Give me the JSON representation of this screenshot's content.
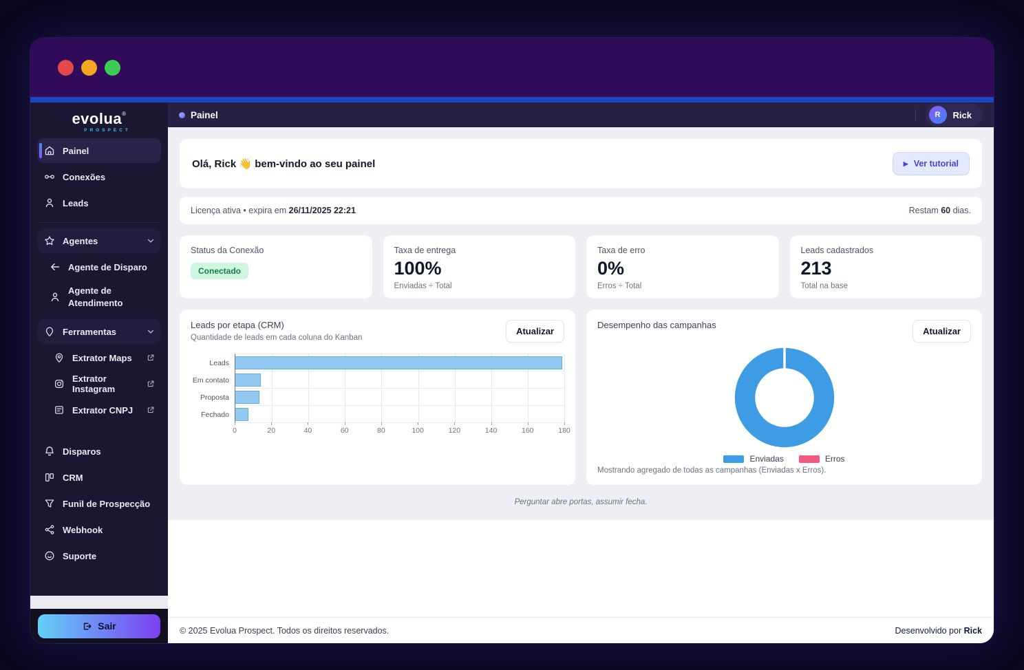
{
  "sidebar": {
    "logo": {
      "text": "evolua",
      "reg": "®",
      "subtext": "PROSPECT"
    },
    "items": [
      {
        "label": "Painel",
        "icon": "home-icon",
        "active": true
      },
      {
        "label": "Conexões",
        "icon": "link-icon"
      },
      {
        "label": "Leads",
        "icon": "user-icon"
      },
      {
        "label": "Agentes",
        "icon": "star-icon",
        "group": true
      },
      {
        "label": "Agente de Disparo",
        "icon": "arrow-left-icon"
      },
      {
        "label": "Agente de Atendimento",
        "icon": "user-icon"
      },
      {
        "label": "Ferramentas",
        "icon": "pin-icon",
        "group": true
      },
      {
        "label": "Extrator Maps",
        "icon": "map-pin-icon",
        "external": true
      },
      {
        "label": "Extrator Instagram",
        "icon": "instagram-icon",
        "external": true
      },
      {
        "label": "Extrator CNPJ",
        "icon": "document-icon",
        "external": true
      },
      {
        "label": "Disparos",
        "icon": "bell-icon"
      },
      {
        "label": "CRM",
        "icon": "kanban-icon"
      },
      {
        "label": "Funil de Prospecção",
        "icon": "funnel-icon"
      },
      {
        "label": "Webhook",
        "icon": "share-icon"
      },
      {
        "label": "Suporte",
        "icon": "smile-icon"
      }
    ],
    "logout_label": "Sair"
  },
  "header": {
    "title": "Painel",
    "user": {
      "initial": "R",
      "name": "Rick"
    }
  },
  "welcome": {
    "title": "Olá, Rick 👋 bem-vindo ao seu painel",
    "tutorial_button": "Ver tutorial",
    "play_icon": "▶"
  },
  "license": {
    "left_prefix": "Licença ativa • expira em ",
    "expiry": "26/11/2025 22:21",
    "right_prefix": "Restam ",
    "days": "60",
    "right_suffix": " dias."
  },
  "stats": [
    {
      "label": "Status da Conexão",
      "badge": "Conectado"
    },
    {
      "label": "Taxa de entrega",
      "value": "100%",
      "sub": "Enviadas ÷ Total"
    },
    {
      "label": "Taxa de erro",
      "value": "0%",
      "sub": "Erros ÷ Total"
    },
    {
      "label": "Leads cadastrados",
      "value": "213",
      "sub": "Total na base"
    }
  ],
  "charts": {
    "bar": {
      "title": "Leads por etapa (CRM)",
      "subtitle": "Quantidade de leads em cada coluna do Kanban",
      "refresh": "Atualizar"
    },
    "donut": {
      "title": "Desempenho das campanhas",
      "refresh": "Atualizar",
      "note": "Mostrando agregado de todas as campanhas (Enviadas x Erros)."
    }
  },
  "chart_data": [
    {
      "type": "bar",
      "orientation": "horizontal",
      "title": "Leads por etapa (CRM)",
      "categories": [
        "Leads",
        "Em contato",
        "Proposta",
        "Fechado"
      ],
      "values": [
        179,
        14,
        13,
        7
      ],
      "xlim": [
        0,
        180
      ],
      "xticks": [
        0,
        20,
        40,
        60,
        80,
        100,
        120,
        140,
        160,
        180
      ],
      "bar_color": "#92c9f2",
      "bar_border": "#66abe0",
      "grid": true,
      "legend_position": "none"
    },
    {
      "type": "pie",
      "donut": true,
      "title": "Desempenho das campanhas",
      "labels": [
        "Enviadas",
        "Erros"
      ],
      "values": [
        100,
        0
      ],
      "colors": [
        "#3d9ce3",
        "#f4587e"
      ],
      "legend_position": "bottom"
    }
  ],
  "quote": "Perguntar abre portas, assumir fecha.",
  "footer": {
    "left": "© 2025 Evolua Prospect. Todos os direitos reservados.",
    "right_prefix": "Desenvolvido por ",
    "right_name": "Rick"
  },
  "colors": {
    "accent_indigo": "#4a43d6",
    "badge_green_bg": "#cdf6de",
    "badge_green_text": "#1b7a45",
    "donut_blue": "#3d9ce3",
    "legend_pink": "#f4587e",
    "titlebar_purple": "#310a59",
    "blue_strip": "#1747c2"
  }
}
